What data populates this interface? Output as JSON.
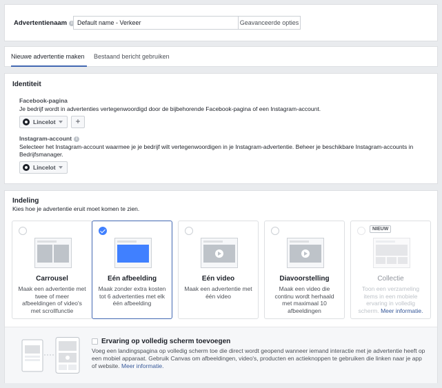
{
  "ad_name": {
    "label": "Advertentienaam",
    "value": "Default name - Verkeer",
    "advanced_button": "Geavanceerde opties"
  },
  "tabs": [
    {
      "label": "Nieuwe advertentie maken",
      "active": true
    },
    {
      "label": "Bestaand bericht gebruiken",
      "active": false
    }
  ],
  "identity": {
    "title": "Identiteit",
    "facebook": {
      "label": "Facebook-pagina",
      "description": "Je bedrijf wordt in advertenties vertegenwoordigd door de bijbehorende Facebook-pagina of een Instagram-account.",
      "selected_page": "Lincelot",
      "add_button": "+"
    },
    "instagram": {
      "label": "Instagram-account",
      "description_line1": "Selecteer het Instagram-account waarmee je je bedrijf wilt vertegenwoordigen in je Instagram-advertentie. Beheer je beschikbare Instagram-accounts in",
      "description_line2": "Bedrijfsmanager.",
      "selected_account": "Lincelot"
    }
  },
  "format": {
    "title": "Indeling",
    "subtitle": "Kies hoe je advertentie eruit moet komen te zien.",
    "options": [
      {
        "title": "Carrousel",
        "description": "Maak een advertentie met twee of meer afbeeldingen of video's met scrollfunctie",
        "selected": false,
        "disabled": false
      },
      {
        "title": "Eén afbeelding",
        "description": "Maak zonder extra kosten tot 6 advertenties met elk één afbeelding",
        "selected": true,
        "disabled": false
      },
      {
        "title": "Eén video",
        "description": "Maak een advertentie met één video",
        "selected": false,
        "disabled": false
      },
      {
        "title": "Diavoorstelling",
        "description": "Maak een video die continu wordt herhaald met maximaal 10 afbeeldingen",
        "selected": false,
        "disabled": false
      },
      {
        "title": "Collectie",
        "description": "Toon een verzameling items in een mobiele ervaring in volledig scherm.",
        "link": "Meer informatie.",
        "badge": "NIEUW",
        "selected": false,
        "disabled": true
      }
    ],
    "canvas": {
      "title": "Ervaring op volledig scherm toevoegen",
      "description": "Voeg een landingspagina op volledig scherm toe die direct wordt geopend wanneer iemand interactie met je advertentie heeft op een mobiel apparaat. Gebruik Canvas om afbeeldingen, video's, producten en actieknoppen te gebruiken die linken naar je app of website.",
      "link": "Meer informatie."
    }
  },
  "colors": {
    "accent": "#4267b2",
    "selected_radio": "#4080ff",
    "background": "#e9ebee"
  }
}
